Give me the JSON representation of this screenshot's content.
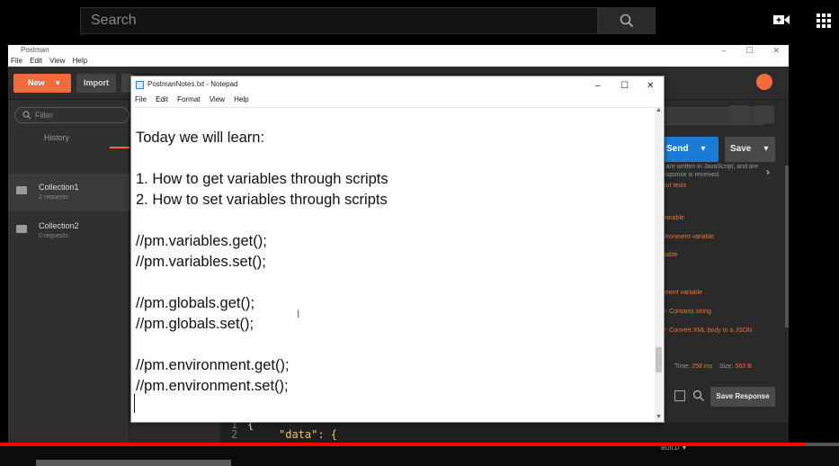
{
  "youtube": {
    "search_placeholder": "Search",
    "icons": [
      "search-icon",
      "create-video-icon",
      "apps-grid-icon"
    ],
    "progress_percent": 96
  },
  "postman": {
    "window_title": "Postman",
    "menu": [
      "File",
      "Edit",
      "View",
      "Help"
    ],
    "new_label": "New",
    "import_label": "Import",
    "filter_placeholder": "Filter",
    "history_tab": "History",
    "collections": [
      {
        "name": "Collection1",
        "sub": "2 requests"
      },
      {
        "name": "Collection2",
        "sub": "0 requests"
      }
    ],
    "send_label": "Send",
    "save_label": "Save",
    "snippets_intro": [
      "ers are written in JavaScript, and are",
      "e response is received."
    ],
    "snippets_link": "about tests",
    "snippets": [
      "al variable",
      "environment variable",
      "variable",
      "le",
      "ronment variable",
      "ody: Contains string",
      "ody: Convert XML body to a JSON"
    ],
    "time_label": "Time:",
    "time_value": "258 ms",
    "size_label": "Size:",
    "size_value": "563 B",
    "save_response_label": "Save Response",
    "code_lines": [
      {
        "num": "1",
        "text": "{"
      },
      {
        "num": "2",
        "text": "\"data\": {"
      }
    ],
    "build_label": "BUILD ▼",
    "accent": "#f26b3a",
    "send_color": "#1c7bd6"
  },
  "notepad": {
    "title": "PostmanNotes.txt - Notepad",
    "menu": [
      "File",
      "Edit",
      "Format",
      "View",
      "Help"
    ],
    "controls": [
      "–",
      "☐",
      "✕"
    ],
    "lines": [
      "Today we will learn:",
      "",
      "1. How to get variables through scripts",
      "2. How to set variables through scripts",
      "",
      "//pm.variables.get();",
      "//pm.variables.set();",
      "",
      "//pm.globals.get();",
      "//pm.globals.set();",
      "",
      "//pm.environment.get();",
      "//pm.environment.set();"
    ]
  }
}
